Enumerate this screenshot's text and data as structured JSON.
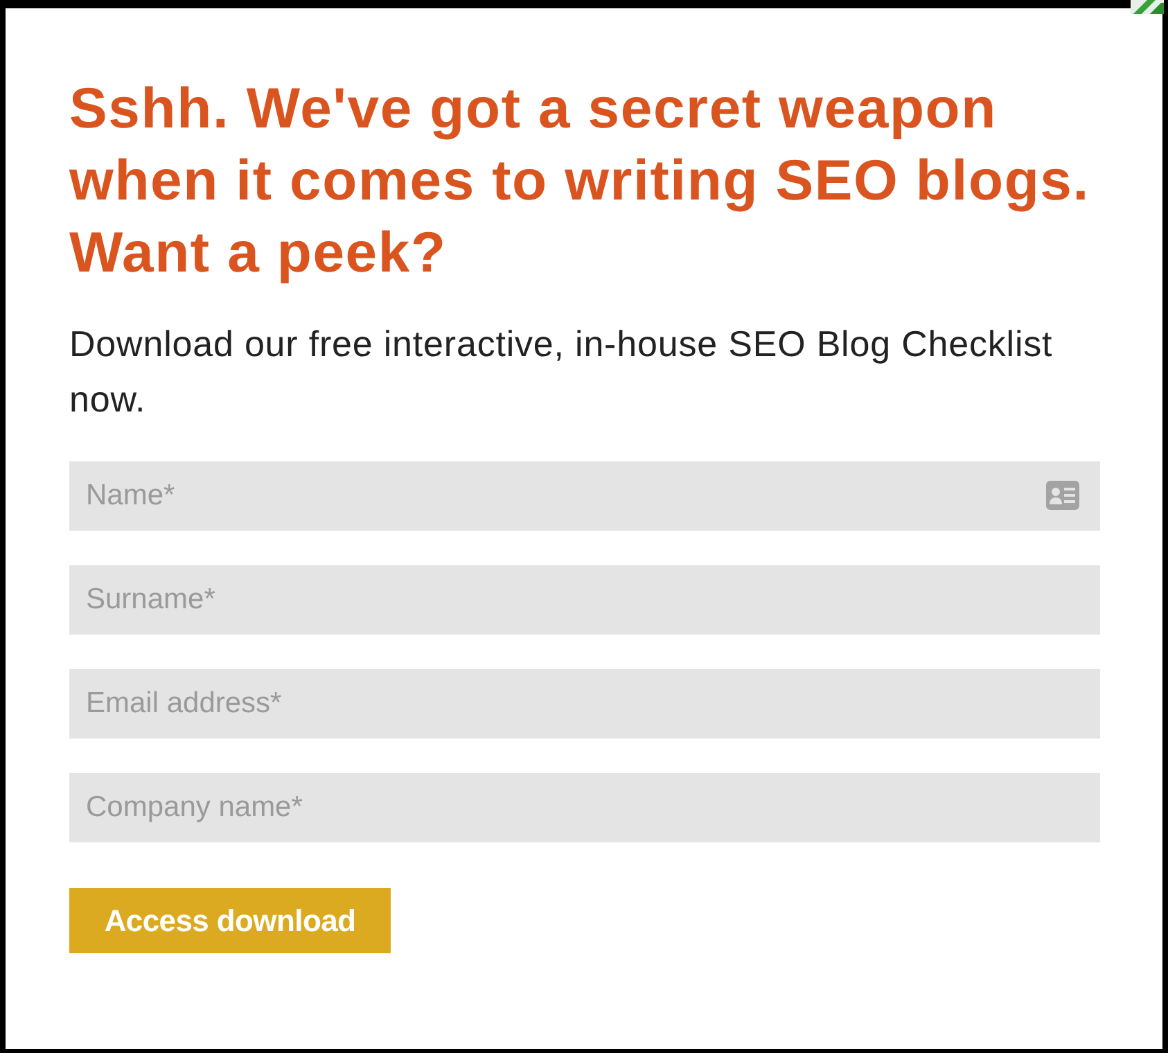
{
  "heading": "Sshh. We've got a secret weapon when it comes to writing SEO blogs. Want a peek?",
  "intro": "Download our free interactive, in-house SEO Blog Checklist now.",
  "fields": [
    {
      "placeholder": "Name*",
      "kind": "card"
    },
    {
      "placeholder": "Surname*",
      "kind": "plain"
    },
    {
      "placeholder": "Email address*",
      "kind": "plain"
    },
    {
      "placeholder": "Company name*",
      "kind": "plain"
    }
  ],
  "button": {
    "label": "Access download"
  }
}
